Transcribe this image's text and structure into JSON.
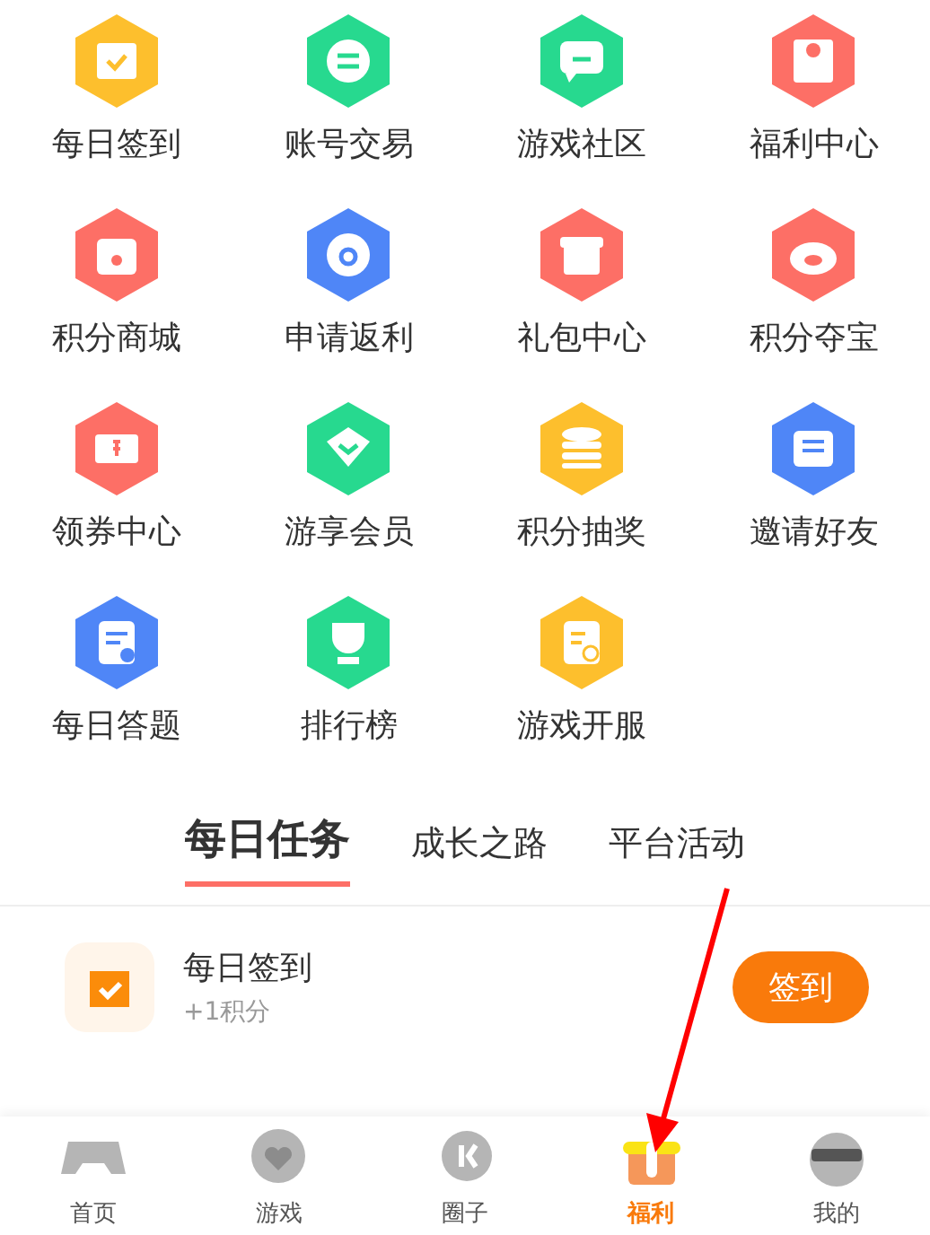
{
  "services": [
    {
      "label": "每日签到",
      "color": "#fdbf2d"
    },
    {
      "label": "账号交易",
      "color": "#27d98f"
    },
    {
      "label": "游戏社区",
      "color": "#27d98f"
    },
    {
      "label": "福利中心",
      "color": "#fd6f66"
    },
    {
      "label": "积分商城",
      "color": "#fd6f66"
    },
    {
      "label": "申请返利",
      "color": "#4f86f7"
    },
    {
      "label": "礼包中心",
      "color": "#fd6f66"
    },
    {
      "label": "积分夺宝",
      "color": "#fd6f66"
    },
    {
      "label": "领券中心",
      "color": "#fd6f66"
    },
    {
      "label": "游享会员",
      "color": "#27d98f"
    },
    {
      "label": "积分抽奖",
      "color": "#fdbf2d"
    },
    {
      "label": "邀请好友",
      "color": "#4f86f7"
    },
    {
      "label": "每日答题",
      "color": "#4f86f7"
    },
    {
      "label": "排行榜",
      "color": "#27d98f"
    },
    {
      "label": "游戏开服",
      "color": "#fdbf2d"
    }
  ],
  "task_tabs": [
    {
      "label": "每日任务",
      "selected": true
    },
    {
      "label": "成长之路",
      "selected": false
    },
    {
      "label": "平台活动",
      "selected": false
    }
  ],
  "tasks": [
    {
      "title": "每日签到",
      "reward": "+1积分",
      "action": "签到"
    }
  ],
  "bottom_nav": [
    {
      "label": "首页",
      "selected": false
    },
    {
      "label": "游戏",
      "selected": false
    },
    {
      "label": "圈子",
      "selected": false
    },
    {
      "label": "福利",
      "selected": true
    },
    {
      "label": "我的",
      "selected": false
    }
  ]
}
